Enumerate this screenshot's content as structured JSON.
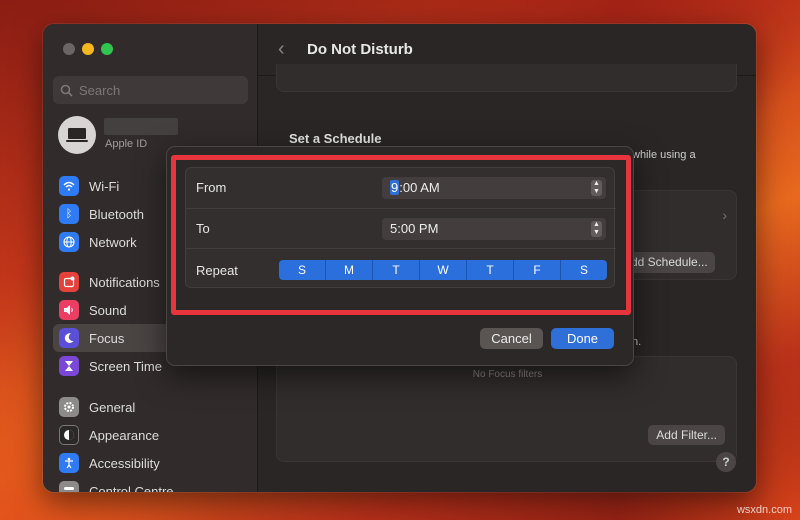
{
  "sidebar": {
    "search_placeholder": "Search",
    "account_label": "Apple ID",
    "items": [
      {
        "label": "Wi-Fi",
        "icon": "wifi-icon"
      },
      {
        "label": "Bluetooth",
        "icon": "bluetooth-icon"
      },
      {
        "label": "Network",
        "icon": "network-globe-icon"
      },
      {
        "label": "Notifications",
        "icon": "notifications-icon"
      },
      {
        "label": "Sound",
        "icon": "sound-icon"
      },
      {
        "label": "Focus",
        "icon": "moon-icon"
      },
      {
        "label": "Screen Time",
        "icon": "hourglass-icon"
      },
      {
        "label": "General",
        "icon": "gear-icon"
      },
      {
        "label": "Appearance",
        "icon": "appearance-icon"
      },
      {
        "label": "Accessibility",
        "icon": "accessibility-icon"
      },
      {
        "label": "Control Centre",
        "icon": "control-centre-icon"
      }
    ]
  },
  "main": {
    "title": "Do Not Disturb",
    "schedule_heading": "Set a Schedule",
    "schedule_desc_fragment": "while using a",
    "add_schedule": "Add Schedule...",
    "add_schedule_visible": "dd Schedule...",
    "filter_fragment": "n.",
    "no_filters": "No Focus filters",
    "add_filter": "Add Filter...",
    "help": "?"
  },
  "sheet": {
    "from_label": "From",
    "from_time_highlight": "9",
    "from_time_rest": ":00 AM",
    "to_label": "To",
    "to_time": "5:00 PM",
    "repeat_label": "Repeat",
    "days": [
      "S",
      "M",
      "T",
      "W",
      "T",
      "F",
      "S"
    ],
    "cancel": "Cancel",
    "done": "Done"
  },
  "watermark": "wsxdn.com",
  "colors": {
    "accent": "#2f6fd8",
    "highlight_border": "#e8343d"
  }
}
